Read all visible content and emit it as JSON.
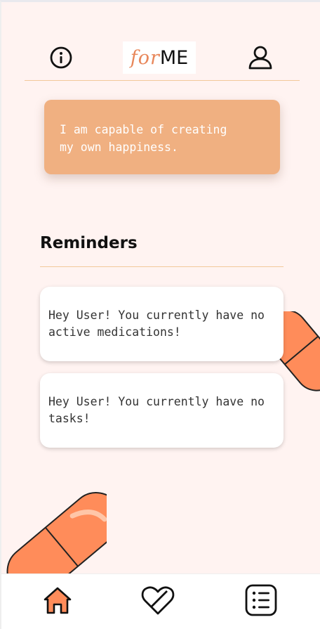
{
  "header": {
    "logo_prefix": "for",
    "logo_suffix": "ME",
    "info_icon": "info-icon",
    "profile_icon": "user-icon"
  },
  "affirmation": {
    "text": "I am capable of creating\nmy own happiness."
  },
  "reminders": {
    "title": "Reminders",
    "cards": [
      {
        "text": "Hey User! You currently have no active medications!"
      },
      {
        "text": "Hey User! You currently have no tasks!"
      }
    ]
  },
  "nav": {
    "items": [
      {
        "icon": "home-icon",
        "active": true
      },
      {
        "icon": "heart-pill-icon",
        "active": false
      },
      {
        "icon": "list-icon",
        "active": false
      }
    ]
  },
  "colors": {
    "background": "#fff3f1",
    "accent": "#f0b081",
    "brand_orange": "#e8875a",
    "pill_orange": "#ff8c5a",
    "divider": "#f2c89a"
  }
}
